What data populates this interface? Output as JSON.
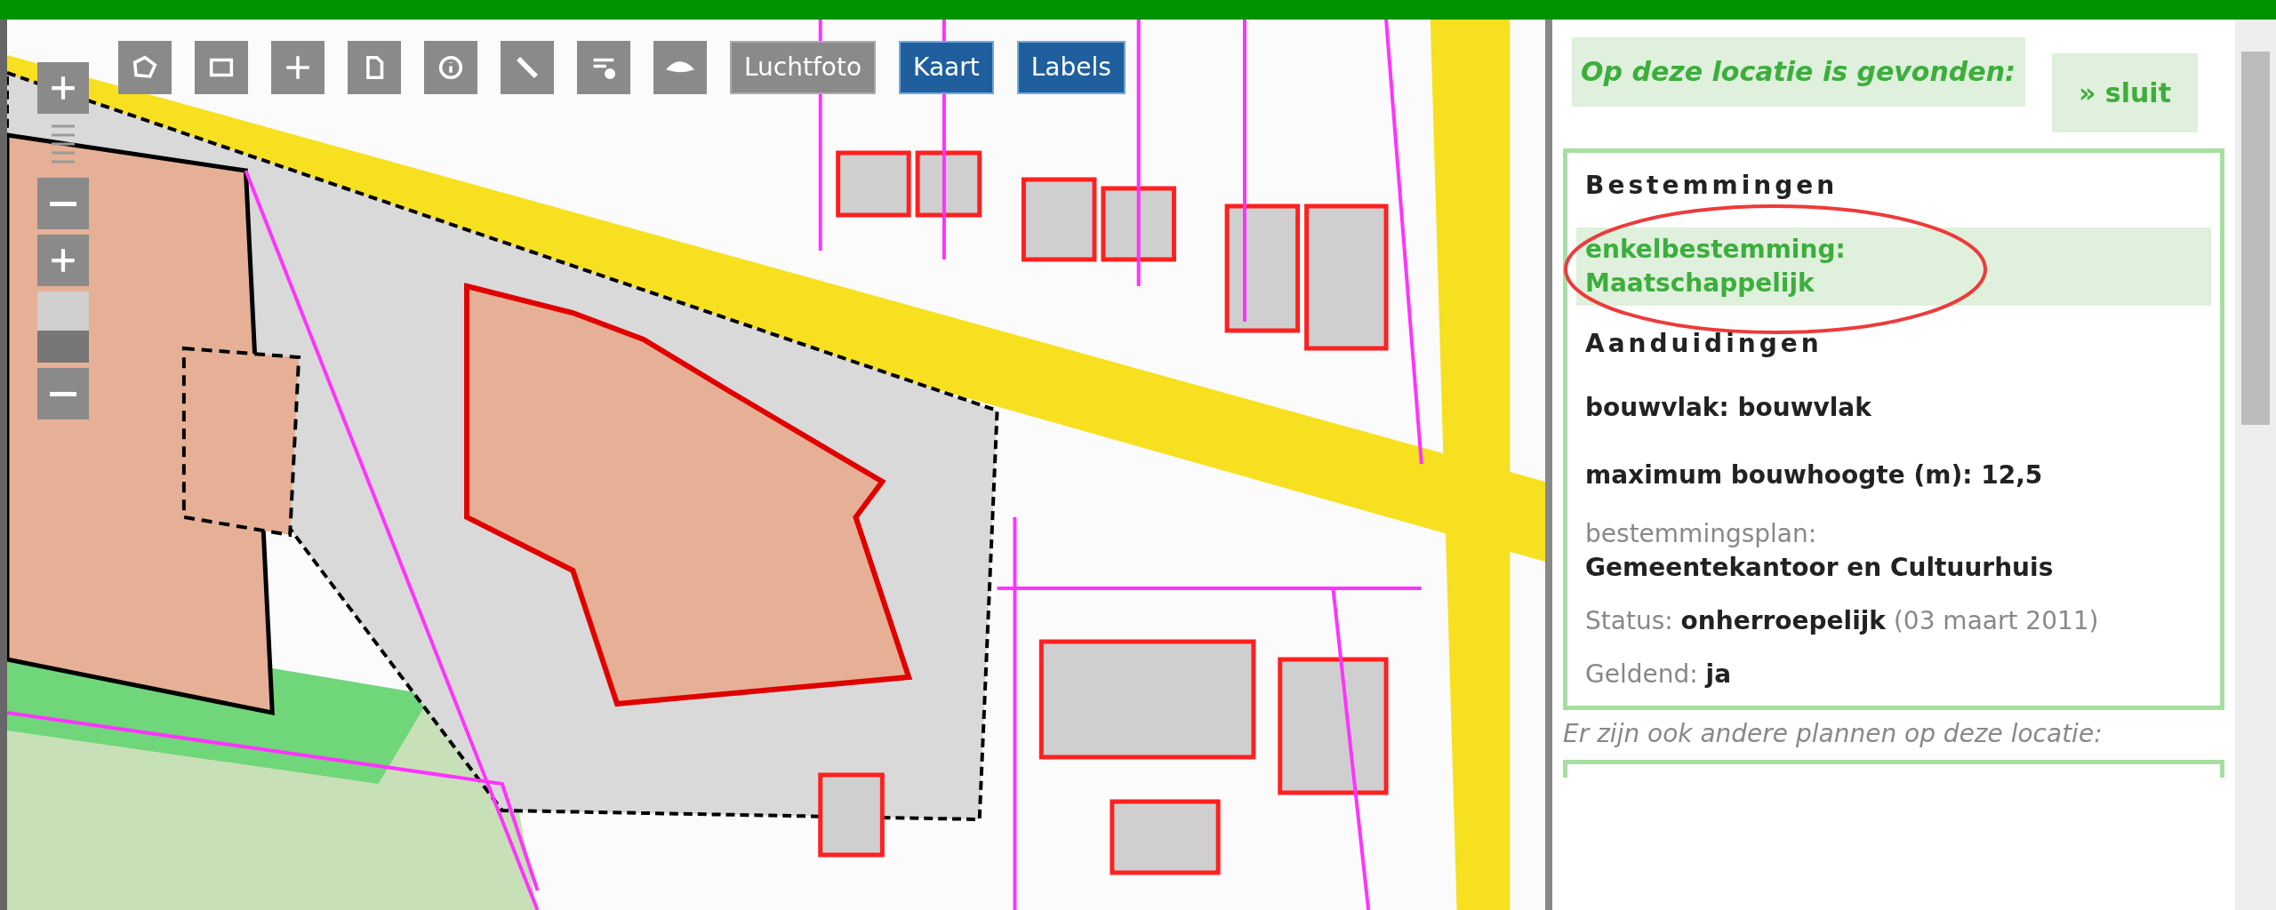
{
  "toolbar": {
    "tools": [
      {
        "kind": "polygon"
      },
      {
        "kind": "rectangle"
      },
      {
        "kind": "pan"
      },
      {
        "kind": "print"
      },
      {
        "kind": "info"
      },
      {
        "kind": "measure"
      },
      {
        "kind": "layers"
      },
      {
        "kind": "eye"
      }
    ],
    "layers": [
      {
        "label": "Luchtfoto",
        "selected": false
      },
      {
        "label": "Kaart",
        "selected": true
      },
      {
        "label": "Labels",
        "selected": true
      }
    ]
  },
  "zoom_controls": [
    {
      "kind": "plus"
    },
    {
      "kind": "ladder"
    },
    {
      "kind": "minus"
    },
    {
      "kind": "plus"
    },
    {
      "kind": "slider",
      "level": 0.45
    },
    {
      "kind": "minus"
    }
  ],
  "panel": {
    "title": "Op deze locatie is gevonden:",
    "close": "» sluit",
    "sections": [
      {
        "heading": "Bestemmingen",
        "items": [
          {
            "text": "enkelbestemming: Maatschappelijk",
            "selected": true
          }
        ]
      },
      {
        "heading": "Aanduidingen",
        "items": [
          {
            "text": "bouwvlak: bouwvlak",
            "selected": false
          },
          {
            "text": "maximum bouwhoogte (m): 12,5",
            "selected": false
          }
        ]
      }
    ],
    "plan": {
      "label": "bestemmingsplan:",
      "value": "Gemeentekantoor en Cultuurhuis"
    },
    "status": {
      "label": "Status:",
      "value": "onherroepelijk",
      "date": "(03 maart 2011)"
    },
    "geldend": {
      "label": "Geldend:",
      "value": "ja"
    },
    "other_plans": "Er zijn ook andere plannen op deze locatie:"
  }
}
